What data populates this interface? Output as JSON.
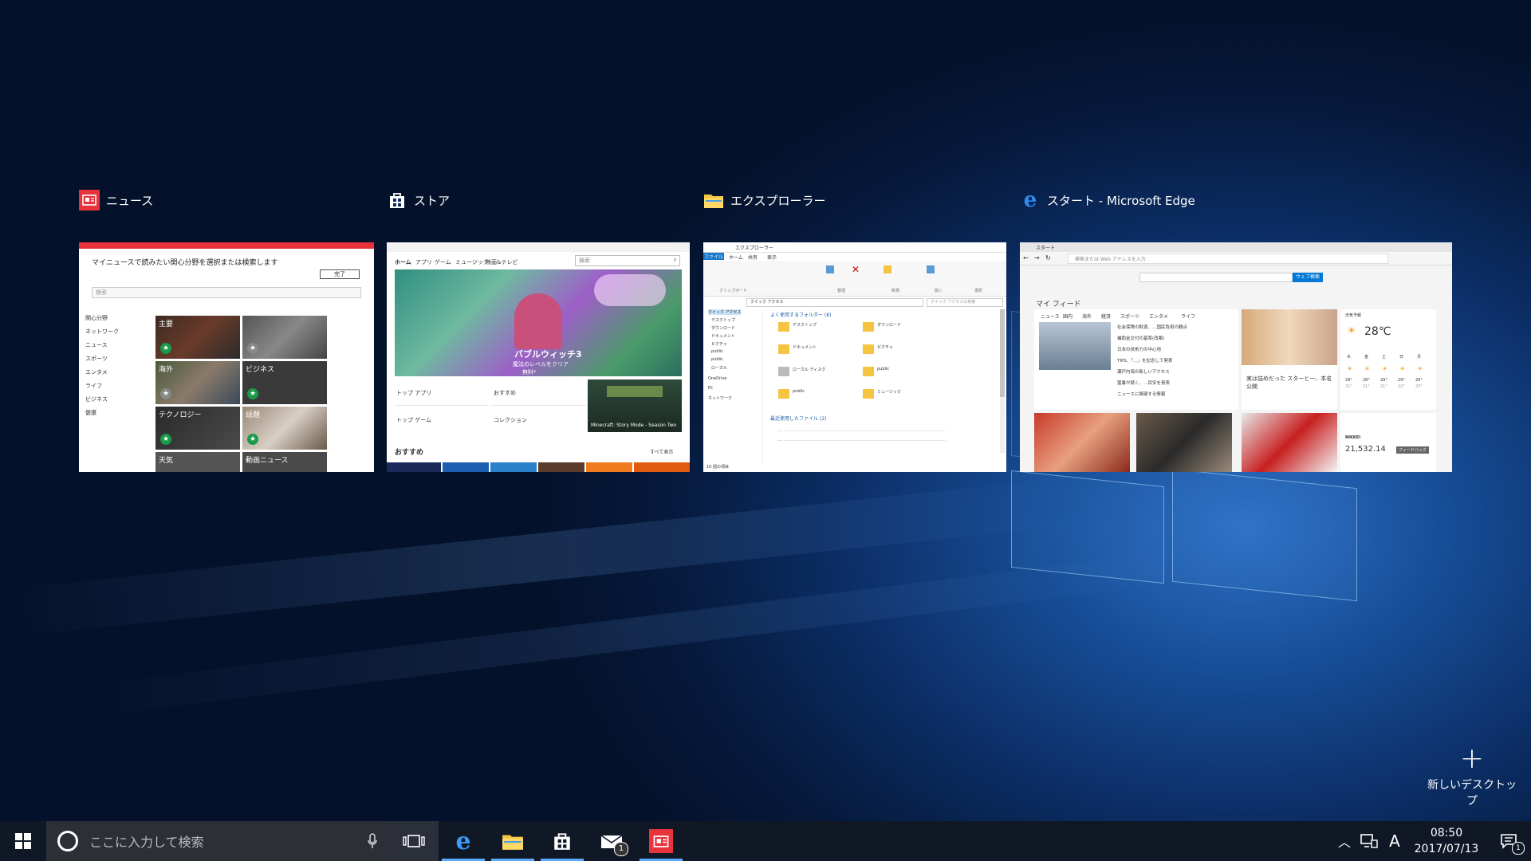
{
  "windows": [
    {
      "title": "ニュース",
      "icon": "news-icon"
    },
    {
      "title": "ストア",
      "icon": "store-icon"
    },
    {
      "title": "エクスプローラー",
      "icon": "folder-icon"
    },
    {
      "title": "スタート - Microsoft Edge",
      "icon": "edge-icon"
    }
  ],
  "news": {
    "heading": "マイニュースで読みたい関心分野を選択または検索します",
    "done": "完了",
    "search_placeholder": "検索",
    "sidebar": [
      "関心分野",
      "ネットワーク",
      "ニュース",
      "スポーツ",
      "エンタメ",
      "ライフ",
      "ビジネス",
      "健康"
    ],
    "tiles": [
      "主要",
      "",
      "海外",
      "ビジネス",
      "テクノロジー",
      "話題",
      "天気",
      "動画ニュース"
    ]
  },
  "store": {
    "nav": [
      "ホーム",
      "アプリ",
      "ゲーム",
      "ミュージック",
      "映画&テレビ"
    ],
    "search_placeholder": "検索",
    "hero_title": "バブルウィッチ3",
    "hero_sub": "魔法のレベルをクリア",
    "hero_price": "無料*",
    "links": [
      "トップ アプリ",
      "おすすめ",
      "トップ ゲーム",
      "コレクション"
    ],
    "minecraft": "Minecraft: Story Mode - Season Two",
    "section": "おすすめ",
    "show_all": "すべて表示"
  },
  "explorer": {
    "title": "エクスプローラー",
    "tabs": [
      "ファイル",
      "ホーム",
      "共有",
      "表示"
    ],
    "ribbon": [
      "クリップボード",
      "整理",
      "新規",
      "開く",
      "選択"
    ],
    "address": "クイック アクセス",
    "search_placeholder": "クイック アクセスの検索",
    "nav": [
      "クイック アクセス",
      "デスクトップ",
      "ダウンロード",
      "ドキュメント",
      "ピクチャ",
      "public",
      "public",
      "ローカル",
      "OneDrive",
      "PC",
      "ネットワーク"
    ],
    "frequent_header": "よく使用するフォルダー (8)",
    "folders": [
      "デスクトップ",
      "ダウンロード",
      "ドキュメント",
      "ピクチャ",
      "ローカル ディスク",
      "public",
      "public",
      "ミュージック"
    ],
    "recent_header": "最近使用したファイル (2)",
    "status": "10 個の項目"
  },
  "edge": {
    "tab": "スタート",
    "address_placeholder": "検索または Web アドレスを入力",
    "web_search_button": "ウェブ検索",
    "feed_title": "マイ フィード",
    "categories": [
      "ニュース",
      "国内",
      "海外",
      "経済",
      "スポーツ",
      "エンタメ",
      "ライフ"
    ],
    "headlines": [
      "社会保障の財源、…国民負担の観点",
      "補助金交付の基準(改案)",
      "日本の技術力の中心地",
      "TIPS、「…」を記念して発表",
      "瀬戸内海の新しいアクセス",
      "猛暑が続く、…目安を発表",
      "ニュースに関連する情報"
    ],
    "story_caption": "実は詰めだった スターと一、本名公開",
    "weather_label": "天気予報",
    "temperature": "28℃",
    "forecast": [
      {
        "day": "木",
        "hi": "29°",
        "lo": "21°"
      },
      {
        "day": "金",
        "hi": "28°",
        "lo": "21°"
      },
      {
        "day": "土",
        "hi": "29°",
        "lo": "21°"
      },
      {
        "day": "日",
        "hi": "29°",
        "lo": "22°"
      },
      {
        "day": "月",
        "hi": "29°",
        "lo": "23°"
      }
    ],
    "market_label": "NIKKEI",
    "market_value": "21,532.14",
    "feedback": "フィードバック"
  },
  "new_desktop": "新しいデスクトップ",
  "taskbar": {
    "search_placeholder": "ここに入力して検索",
    "mail_badge": "1",
    "ime": "A",
    "time": "08:50",
    "date": "2017/07/13",
    "notification_badge": "1"
  },
  "colors": {
    "news_red": "#e8323c",
    "accent_blue": "#0078d7",
    "taskbar": "#101826",
    "store_green": "#1a9a48"
  }
}
